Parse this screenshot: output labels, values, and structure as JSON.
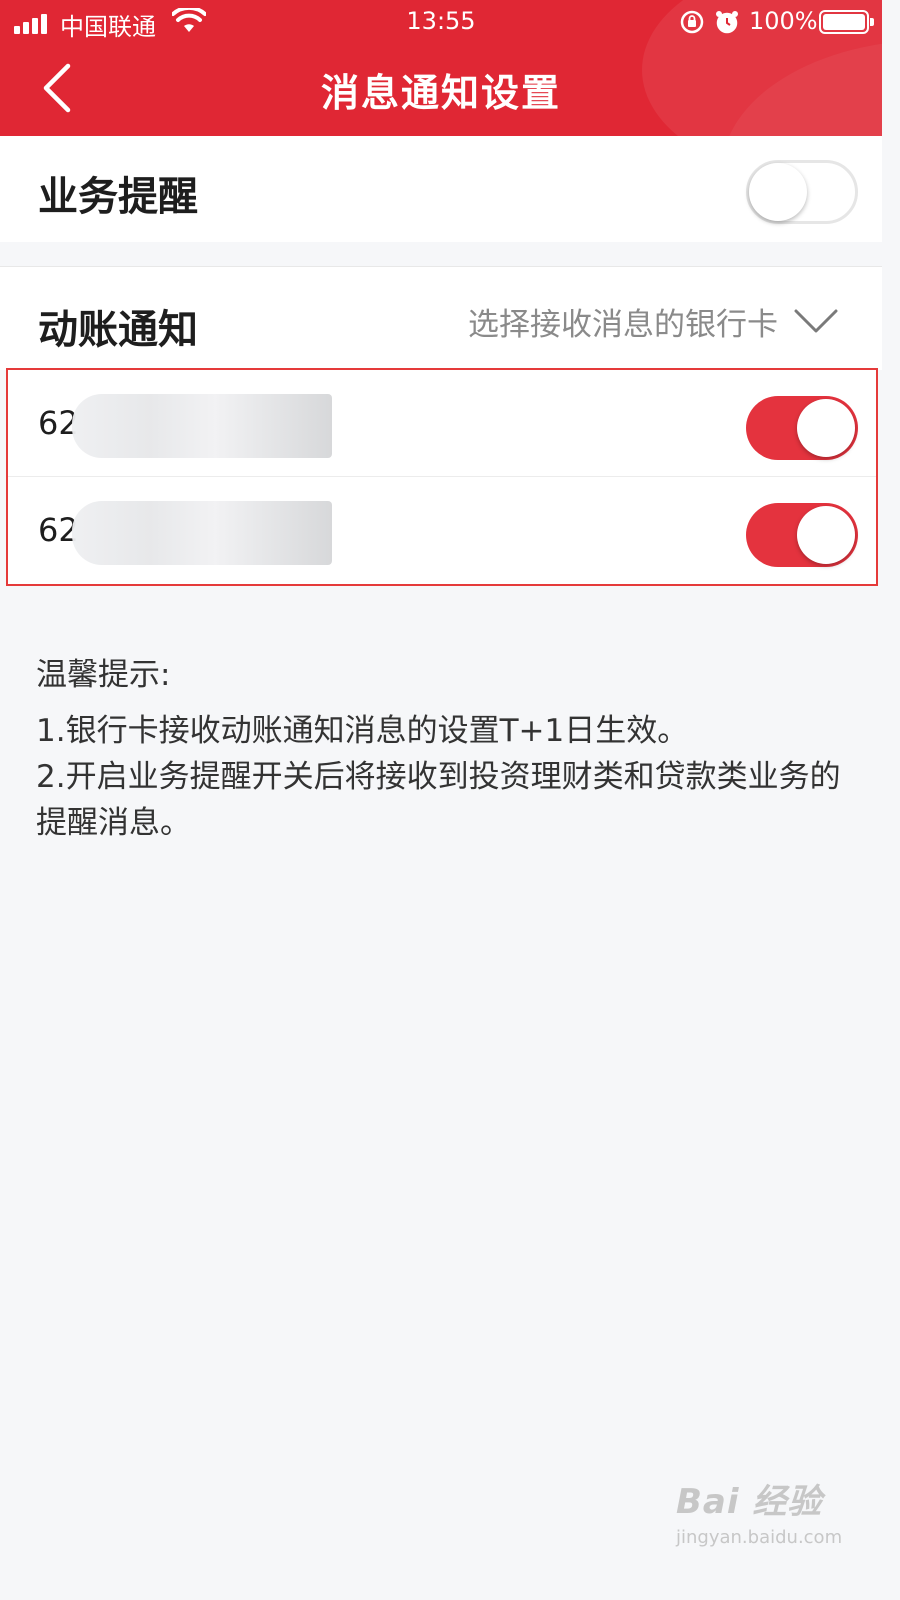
{
  "status_bar": {
    "carrier": "中国联通",
    "time": "13:55",
    "battery": "100%"
  },
  "header": {
    "title": "消息通知设置",
    "back_icon": "chevron-left-icon"
  },
  "business_reminder": {
    "label": "业务提醒",
    "enabled": false
  },
  "account_change": {
    "label": "动账通知",
    "selector_text": "选择接收消息的银行卡",
    "selector_icon": "chevron-down-icon"
  },
  "cards": [
    {
      "number_prefix": "62",
      "enabled": true
    },
    {
      "number_prefix": "62",
      "enabled": true
    }
  ],
  "tips": {
    "title": "温馨提示:",
    "line1": "1.银行卡接收动账通知消息的设置T+1日生效。",
    "line2": "2.开启业务提醒开关后将接收到投资理财类和贷款类业务的提醒消息。"
  },
  "watermark": {
    "main": "Bai 经验",
    "sub": "jingyan.baidu.com"
  },
  "colors": {
    "brand_red": "#e02734",
    "toggle_on": "#e4333e",
    "highlight_border": "#e53a3a"
  }
}
